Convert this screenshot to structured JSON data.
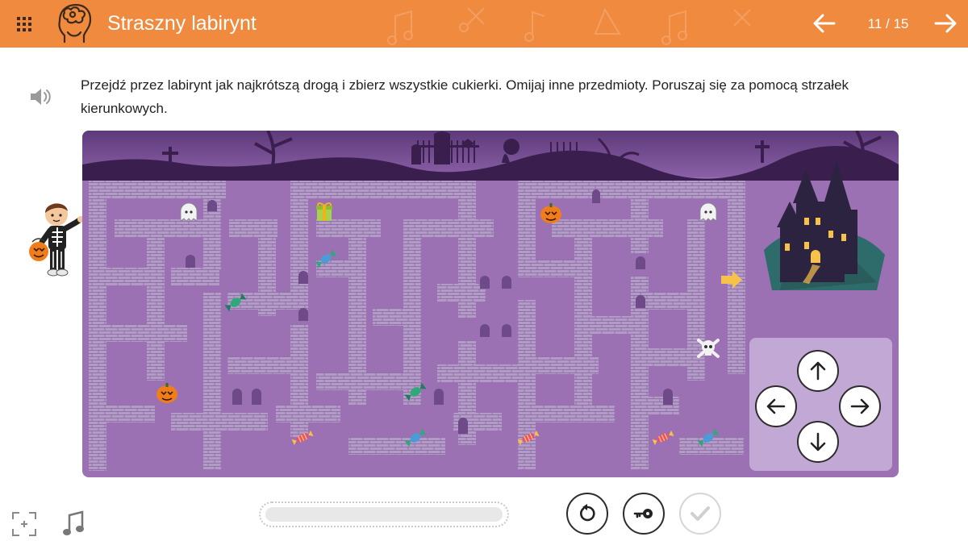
{
  "header": {
    "title": "Straszny labirynt",
    "page_counter": "11 / 15",
    "menu_icon": "grid-menu-icon",
    "logo_icon": "brain-head-logo-icon",
    "prev_icon": "arrow-left-icon",
    "next_icon": "arrow-right-icon",
    "background_color": "#f08a3e"
  },
  "instruction": {
    "text": "Przejdź przez labirynt jak najkrótszą drogą i zbierz wszystkie cukierki. Omijaj inne przedmioty. Poruszaj się za pomocą strzałek kierunkowych.",
    "speaker_icon": "speaker-icon"
  },
  "game": {
    "player": "skeleton-costume-boy-with-pumpkin-bucket",
    "goal": "haunted-castle",
    "goal_arrow_icon": "arrow-right-icon",
    "items": [
      {
        "type": "ghost"
      },
      {
        "type": "gift"
      },
      {
        "type": "pumpkin"
      },
      {
        "type": "ghost"
      },
      {
        "type": "wrapped-candy"
      },
      {
        "type": "wrapped-candy"
      },
      {
        "type": "pumpkin"
      },
      {
        "type": "wrapped-candy"
      },
      {
        "type": "skull-crossbones"
      },
      {
        "type": "striped-candy"
      },
      {
        "type": "wrapped-candy"
      },
      {
        "type": "striped-candy"
      },
      {
        "type": "striped-candy"
      },
      {
        "type": "wrapped-candy"
      }
    ],
    "colors": {
      "sky": "#7a4f96",
      "maze_floor": "#9b71b3",
      "wall": "#b49bc7"
    }
  },
  "controls": {
    "up_icon": "arrow-up-icon",
    "left_icon": "arrow-left-icon",
    "right_icon": "arrow-right-icon",
    "down_icon": "arrow-down-icon"
  },
  "footer": {
    "fullscreen_icon": "fullscreen-icon",
    "music_icon": "music-note-icon",
    "progress": 0,
    "reset_icon": "reset-icon",
    "key_icon": "key-icon",
    "check_icon": "check-icon"
  }
}
